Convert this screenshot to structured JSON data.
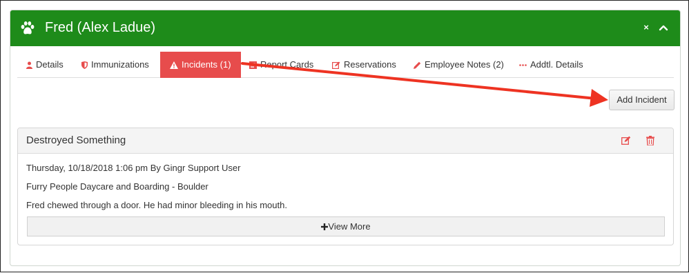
{
  "header": {
    "title": "Fred (Alex Ladue)",
    "close_glyph": "×",
    "paw_icon": "paw-icon",
    "collapse_icon": "chevron-up-icon",
    "color": "#1e8b1a"
  },
  "tabs": [
    {
      "label": "Details",
      "icon": "user-icon"
    },
    {
      "label": "Immunizations",
      "icon": "shield-icon"
    },
    {
      "label": "Incidents (1)",
      "icon": "warning-icon",
      "active": true
    },
    {
      "label": "Report Cards",
      "icon": "report-card-icon"
    },
    {
      "label": "Reservations",
      "icon": "edit-icon"
    },
    {
      "label": "Employee Notes (2)",
      "icon": "pencil-icon"
    },
    {
      "label": "Addtl. Details",
      "icon": "dots-icon"
    }
  ],
  "active_tab_color": "#e74c4c",
  "add_incident_label": "Add Incident",
  "incident": {
    "title": "Destroyed Something",
    "timestamp_line": "Thursday, 10/18/2018 1:06 pm By Gingr Support User",
    "location": "Furry People Daycare and Boarding - Boulder",
    "description": "Fred chewed through a door. He had minor bleeding in his mouth.",
    "view_more_label": "View More",
    "view_more_icon": "plus-icon",
    "edit_icon": "edit-icon",
    "delete_icon": "trash-icon"
  },
  "annotation": {
    "color": "#ee3322",
    "icon": "arrow-annotation"
  }
}
